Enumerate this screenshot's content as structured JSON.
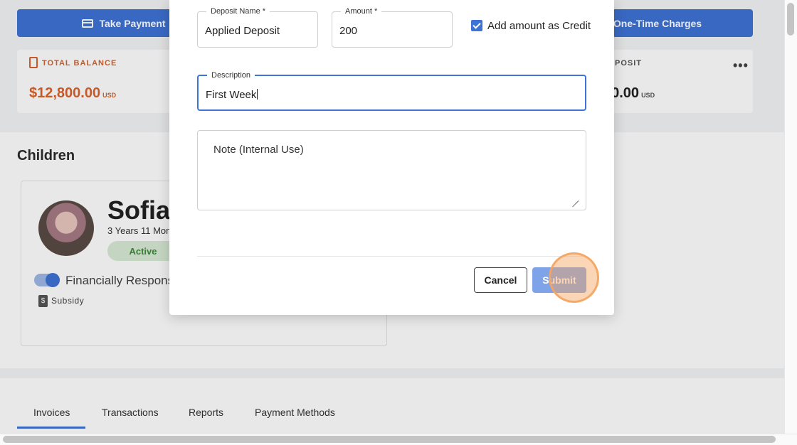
{
  "header": {
    "take_payment_label": "Take Payment",
    "one_time_charges_label": "One-Time Charges"
  },
  "stats": {
    "total_balance_label": "TOTAL BALANCE",
    "total_balance_value": "$12,800.00",
    "total_balance_unit": "USD",
    "deposit_label": "POSIT",
    "deposit_value": "00.00",
    "deposit_unit": "USD"
  },
  "children": {
    "title": "Children",
    "child": {
      "name": "Sofia",
      "age": "3 Years 11 Mon",
      "status": "Active",
      "financially_responsible_label": "Financially Responsib",
      "subsidy_label": "Subsidy"
    }
  },
  "tabs": [
    {
      "label": "Invoices",
      "active": true
    },
    {
      "label": "Transactions",
      "active": false
    },
    {
      "label": "Reports",
      "active": false
    },
    {
      "label": "Payment Methods",
      "active": false
    }
  ],
  "modal": {
    "deposit_name": {
      "label": "Deposit Name *",
      "value": "Applied Deposit"
    },
    "amount": {
      "label": "Amount *",
      "value": "200"
    },
    "add_credit": {
      "label": "Add amount as Credit",
      "checked": true
    },
    "description": {
      "label": "Description",
      "value": "First Week"
    },
    "note": {
      "placeholder": "Note (Internal Use)"
    },
    "cancel_label": "Cancel",
    "submit_label": "Submit"
  },
  "colors": {
    "primary": "#3f73d6",
    "balance_accent": "#d9622b",
    "active_green": "#3e8a3a",
    "submit_disabled": "#7fa3e8"
  }
}
